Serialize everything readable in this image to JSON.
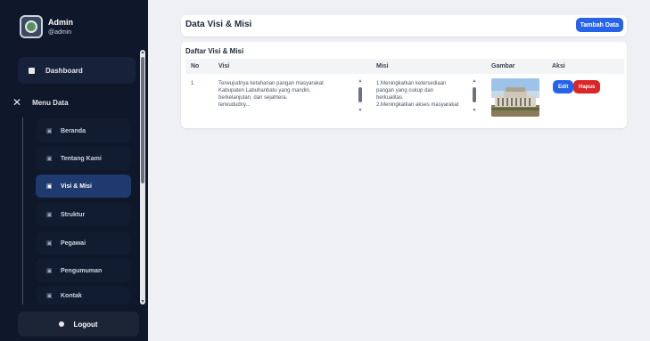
{
  "sidebar": {
    "admin_name": "Admin",
    "admin_user": "@admin",
    "dashboard_label": "Dashboard",
    "menu_data_label": "Menu Data",
    "items": [
      {
        "label": "Beranda",
        "icon": "file-icon"
      },
      {
        "label": "Tentang Kami",
        "icon": "file-icon"
      },
      {
        "label": "Visi & Misi",
        "icon": "file-icon",
        "active": true
      },
      {
        "label": "Struktur",
        "icon": "file-icon"
      },
      {
        "label": "Pegawai",
        "icon": "file-icon"
      },
      {
        "label": "Pengumuman",
        "icon": "file-icon"
      },
      {
        "label": "Kontak",
        "icon": "file-icon"
      }
    ],
    "logout_label": "Logout"
  },
  "header": {
    "title": "Data Visi & Misi",
    "add_button": "Tambah Data"
  },
  "table": {
    "title": "Daftar Visi & Misi",
    "columns": [
      "No",
      "Visi",
      "Misi",
      "Gambar",
      "Aksi"
    ],
    "rows": [
      {
        "no": "1",
        "visi_lines": [
          "Terwujudnya ketahanan pangan masyarakat",
          "Kabupaten Labuhanbatu yang mandiri,",
          "berkelanjutan, dan sejahtera.",
          "terwududny..."
        ],
        "misi_lines": [
          "1.Meningkatkan ketersediaan",
          "pangan yang cukup dan",
          "berkualitas.",
          "2.Meningkatkan akses masyarakat"
        ],
        "edit_label": "Edit",
        "delete_label": "Hapus"
      }
    ]
  },
  "colors": {
    "sidebar_bg": "#0f172a",
    "active_item": "#1e3a6e",
    "primary": "#2563eb",
    "danger": "#dc2626"
  }
}
